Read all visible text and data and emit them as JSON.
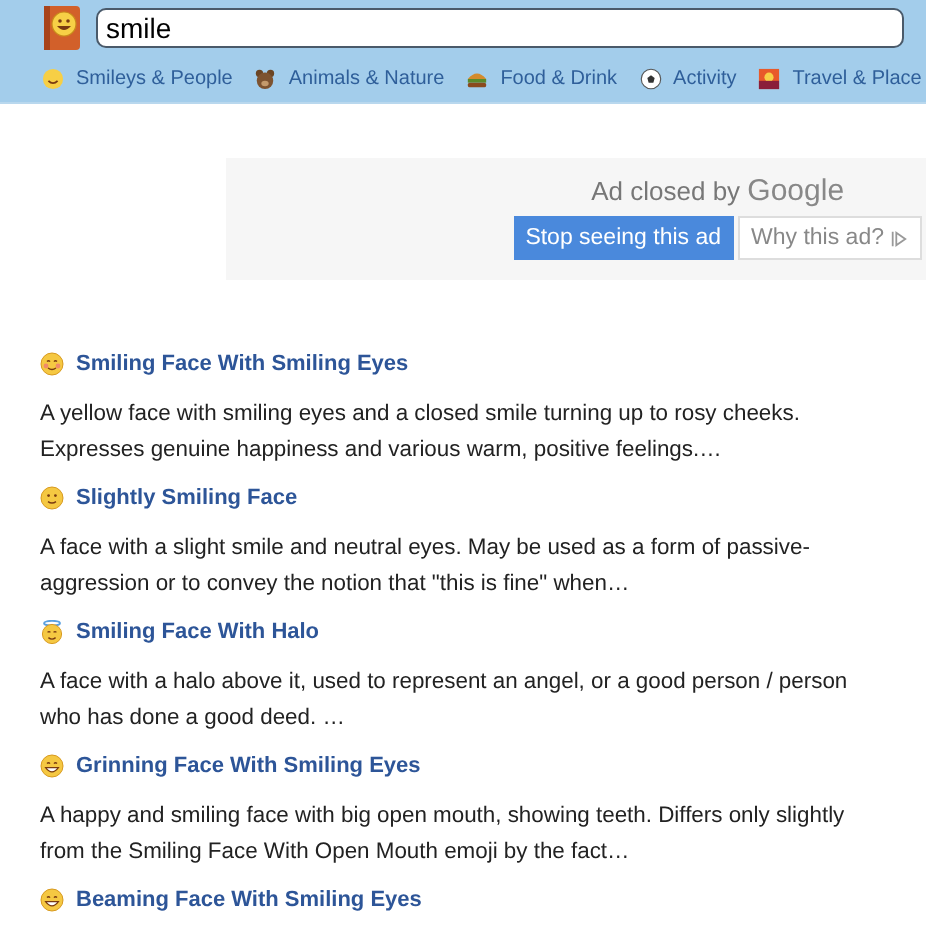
{
  "search": {
    "value": "smile"
  },
  "categories": [
    {
      "label": "Smileys & People",
      "kind": "smiley"
    },
    {
      "label": "Animals & Nature",
      "kind": "bear"
    },
    {
      "label": "Food & Drink",
      "kind": "burger"
    },
    {
      "label": "Activity",
      "kind": "ball"
    },
    {
      "label": "Travel & Place",
      "kind": "sunset"
    }
  ],
  "ad": {
    "message": "Ad closed by ",
    "brand": "Google",
    "stop_button": "Stop seeing this ad",
    "why_button": "Why this ad?"
  },
  "results": [
    {
      "title": "Smiling Face With Smiling Eyes",
      "kind": "blush",
      "description": "A yellow face with smiling eyes and a closed smile turning up to rosy cheeks. Expresses genuine happiness and various warm, positive feelings.…"
    },
    {
      "title": "Slightly Smiling Face",
      "kind": "slight",
      "description": "A face with a slight smile and neutral eyes. May be used as a form of passive-aggression or to convey the notion that \"this is fine\" when…"
    },
    {
      "title": "Smiling Face With Halo",
      "kind": "halo",
      "description": "A face with a halo above it, used to represent an angel, or a good person / person who has done a good deed. …"
    },
    {
      "title": "Grinning Face With Smiling Eyes",
      "kind": "grin",
      "description": "A happy and smiling face with big open mouth, showing teeth. Differs only slightly from the Smiling Face With Open Mouth emoji by the fact…"
    },
    {
      "title": "Beaming Face With Smiling Eyes",
      "kind": "beam"
    }
  ]
}
